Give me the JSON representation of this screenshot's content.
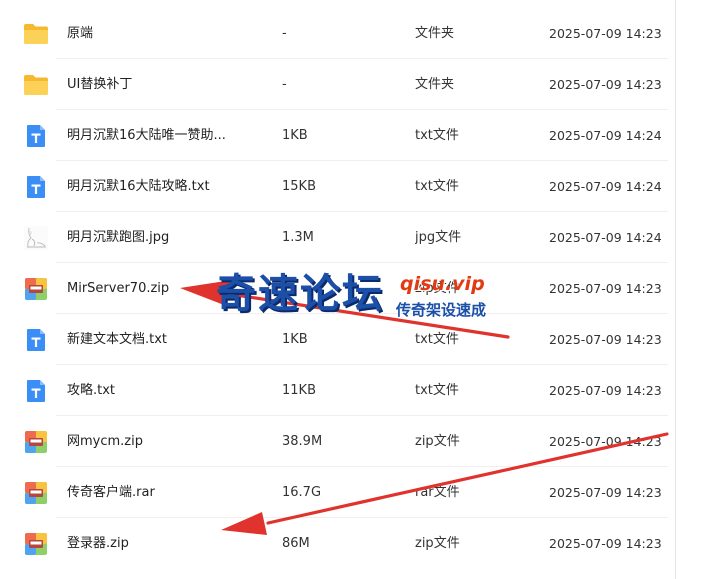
{
  "files": [
    {
      "icon": "folder-icon",
      "name": "原端",
      "size": "-",
      "type": "文件夹",
      "date": "2025-07-09 14:23"
    },
    {
      "icon": "folder-icon",
      "name": "UI替换补丁",
      "size": "-",
      "type": "文件夹",
      "date": "2025-07-09 14:23"
    },
    {
      "icon": "txt-file-icon",
      "name": "明月沉默16大陆唯一赞助...",
      "size": "1KB",
      "type": "txt文件",
      "date": "2025-07-09 14:24"
    },
    {
      "icon": "txt-file-icon",
      "name": "明月沉默16大陆攻略.txt",
      "size": "15KB",
      "type": "txt文件",
      "date": "2025-07-09 14:24"
    },
    {
      "icon": "jpg-thumbnail-icon",
      "name": "明月沉默跑图.jpg",
      "size": "1.3M",
      "type": "jpg文件",
      "date": "2025-07-09 14:24"
    },
    {
      "icon": "archive-file-icon",
      "name": "MirServer70.zip",
      "size": "",
      "type": "zip文件",
      "date": "2025-07-09 14:23"
    },
    {
      "icon": "txt-file-icon",
      "name": "新建文本文档.txt",
      "size": "1KB",
      "type": "txt文件",
      "date": "2025-07-09 14:23"
    },
    {
      "icon": "txt-file-icon",
      "name": "攻略.txt",
      "size": "11KB",
      "type": "txt文件",
      "date": "2025-07-09 14:23"
    },
    {
      "icon": "archive-file-icon",
      "name": "网mycm.zip",
      "size": "38.9M",
      "type": "zip文件",
      "date": "2025-07-09 14:23"
    },
    {
      "icon": "archive-file-icon",
      "name": "传奇客户端.rar",
      "size": "16.7G",
      "type": "rar文件",
      "date": "2025-07-09 14:23"
    },
    {
      "icon": "archive-file-icon",
      "name": "登录器.zip",
      "size": "86M",
      "type": "zip文件",
      "date": "2025-07-09 14:23"
    }
  ],
  "watermark": {
    "main": "奇速论坛",
    "url": "qisu.vip",
    "sub": "传奇架设速成"
  },
  "colors": {
    "folder": "#f7c94a",
    "txt_icon": "#3a8ef6",
    "watermark_blue": "#1b4fa8",
    "watermark_red": "#e23a12",
    "arrow_red": "#e0332e"
  }
}
